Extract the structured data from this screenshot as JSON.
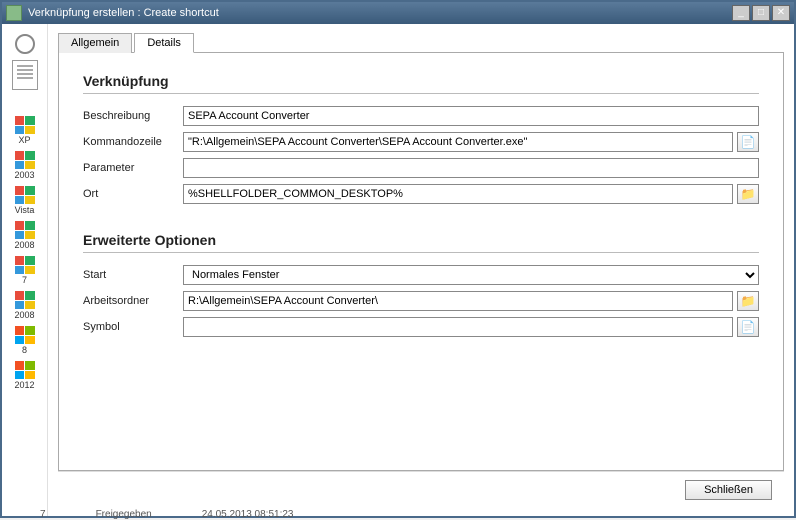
{
  "window": {
    "title": "Verknüpfung erstellen : Create shortcut"
  },
  "tabs": {
    "allgemein": "Allgemein",
    "details": "Details"
  },
  "sections": {
    "shortcut": "Verknüpfung",
    "extended": "Erweiterte Optionen"
  },
  "labels": {
    "beschreibung": "Beschreibung",
    "kommandozeile": "Kommandozeile",
    "parameter": "Parameter",
    "ort": "Ort",
    "start": "Start",
    "arbeitsordner": "Arbeitsordner",
    "symbol": "Symbol"
  },
  "values": {
    "beschreibung": "SEPA Account Converter",
    "kommandozeile": "\"R:\\Allgemein\\SEPA Account Converter\\SEPA Account Converter.exe\"",
    "parameter": "",
    "ort": "%SHELLFOLDER_COMMON_DESKTOP%",
    "start": "Normales Fenster",
    "arbeitsordner": "R:\\Allgemein\\SEPA Account Converter\\",
    "symbol": ""
  },
  "buttons": {
    "close": "Schließen"
  },
  "left_rail": {
    "items": [
      "XP",
      "2003",
      "Vista",
      "2008",
      "7",
      "2008",
      "8",
      "2012"
    ]
  },
  "status": {
    "col1": "7",
    "col2": "Freigegeben",
    "col3": "24.05.2013 08:51:23"
  }
}
